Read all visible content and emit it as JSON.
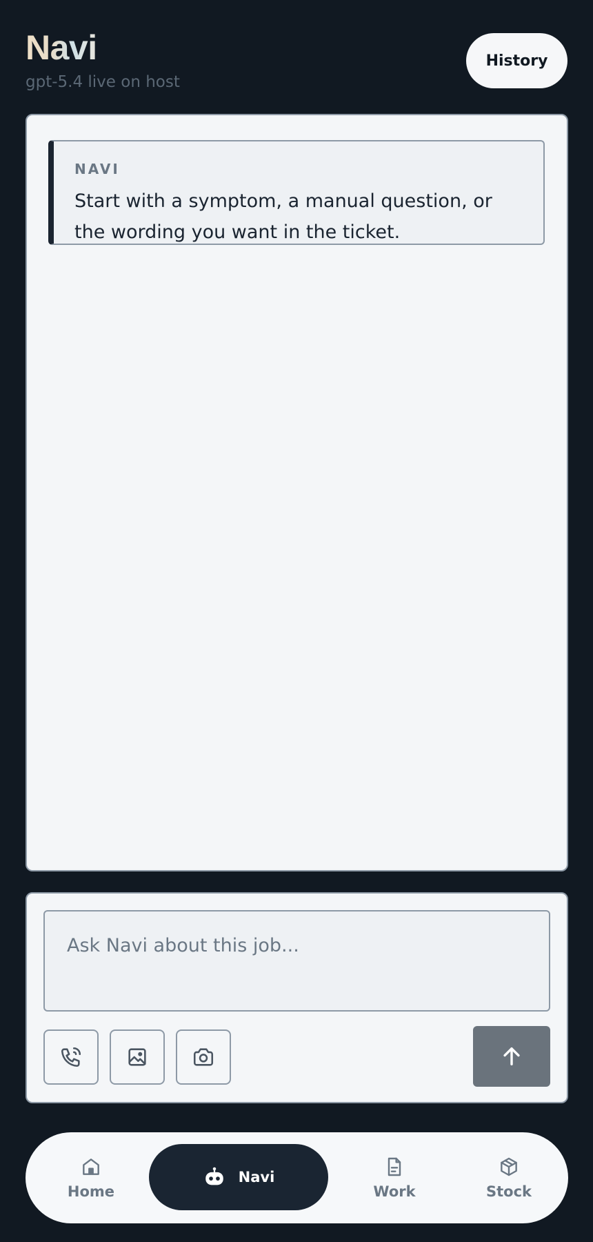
{
  "header": {
    "title": "Navi",
    "subtitle": "gpt-5.4 live on host",
    "history_label": "History"
  },
  "chat": {
    "messages": [
      {
        "author": "NAVI",
        "text": "Start with a symptom, a manual question, or the wording you want in the ticket."
      }
    ]
  },
  "composer": {
    "placeholder": "Ask Navi about this job...",
    "value": "",
    "tools": [
      {
        "icon": "phone-call-icon"
      },
      {
        "icon": "image-icon"
      },
      {
        "icon": "camera-icon"
      }
    ],
    "send_icon": "arrow-up-icon"
  },
  "nav": {
    "items": [
      {
        "label": "Home",
        "icon": "home-icon",
        "active": false
      },
      {
        "label": "Navi",
        "icon": "robot-icon",
        "active": true
      },
      {
        "label": "Work",
        "icon": "document-icon",
        "active": false
      },
      {
        "label": "Stock",
        "icon": "box-icon",
        "active": false
      }
    ]
  },
  "colors": {
    "background": "#111922",
    "panel": "#f4f6f8",
    "accent_dark": "#1a2532",
    "muted": "#6a7784",
    "send_button": "#6a737c"
  }
}
